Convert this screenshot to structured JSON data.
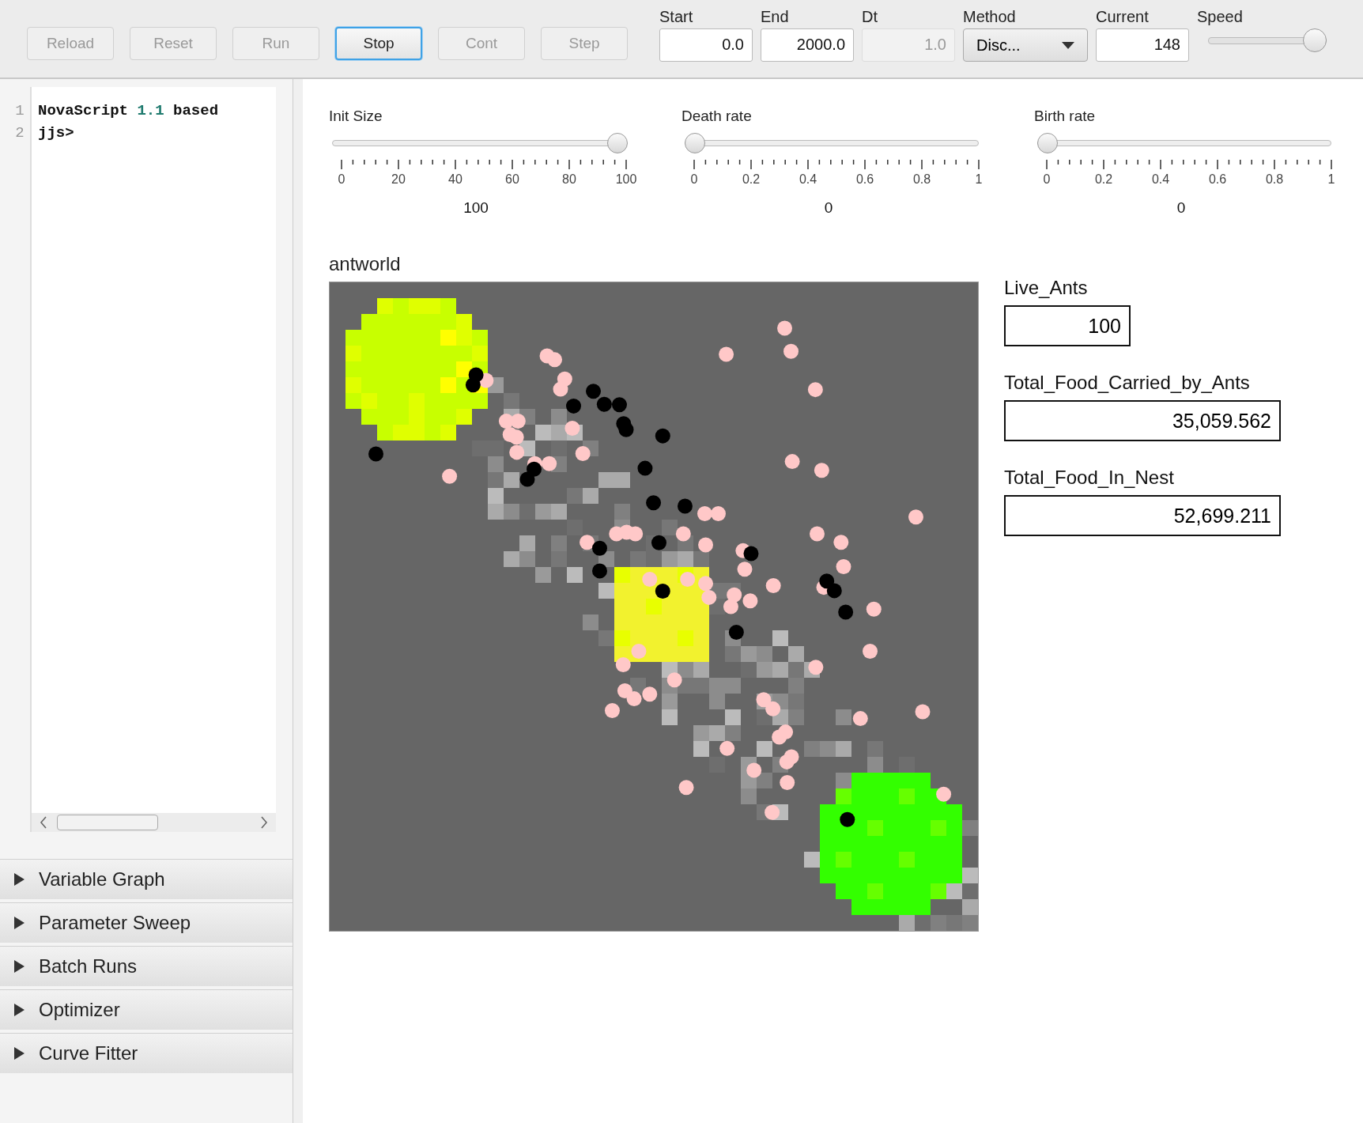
{
  "toolbar": {
    "buttons": [
      {
        "label": "Reload",
        "disabled": true,
        "focused": false
      },
      {
        "label": "Reset",
        "disabled": true,
        "focused": false
      },
      {
        "label": "Run",
        "disabled": true,
        "focused": false
      },
      {
        "label": "Stop",
        "disabled": false,
        "focused": true
      },
      {
        "label": "Cont",
        "disabled": true,
        "focused": false
      },
      {
        "label": "Step",
        "disabled": true,
        "focused": false
      }
    ],
    "fields": [
      {
        "label": "Start",
        "kind": "text",
        "value": "0.0",
        "disabled": false
      },
      {
        "label": "End",
        "kind": "text",
        "value": "2000.0",
        "disabled": false
      },
      {
        "label": "Dt",
        "kind": "text",
        "value": "1.0",
        "disabled": true
      },
      {
        "label": "Method",
        "kind": "dropdown",
        "value": "Disc..."
      },
      {
        "label": "Current",
        "kind": "text",
        "value": "148",
        "disabled": false
      },
      {
        "label": "Speed",
        "kind": "slider",
        "level": 1.0
      }
    ]
  },
  "editor": {
    "lines": [
      {
        "number": "1",
        "parts": [
          {
            "text": "NovaScript ",
            "kind": "plain"
          },
          {
            "text": "1.1",
            "kind": "number"
          },
          {
            "text": " based",
            "kind": "plain"
          }
        ]
      },
      {
        "number": "2",
        "parts": [
          {
            "text": "jjs>",
            "kind": "plain"
          }
        ]
      }
    ]
  },
  "panels": [
    {
      "label": "Variable Graph",
      "expanded": false
    },
    {
      "label": "Parameter Sweep",
      "expanded": false
    },
    {
      "label": "Batch Runs",
      "expanded": false
    },
    {
      "label": "Optimizer",
      "expanded": false
    },
    {
      "label": "Curve Fitter",
      "expanded": false
    }
  ],
  "sliders": [
    {
      "label": "Init Size",
      "level": 1.0,
      "ticks": [
        "0",
        "20",
        "40",
        "60",
        "80",
        "100"
      ],
      "value": "100"
    },
    {
      "label": "Death rate",
      "level": 0.0,
      "ticks": [
        "0",
        "0.2",
        "0.4",
        "0.6",
        "0.8",
        "1"
      ],
      "value": "0"
    },
    {
      "label": "Birth rate",
      "level": 0.0,
      "ticks": [
        "0",
        "0.2",
        "0.4",
        "0.6",
        "0.8",
        "1"
      ],
      "value": "0"
    }
  ],
  "world": {
    "title": "antworld"
  },
  "monitors": [
    {
      "label": "Live_Ants",
      "value": "100"
    },
    {
      "label": "Total_Food_Carried_by_Ants",
      "value": "35,059.562"
    },
    {
      "label": "Total_Food_In_Nest",
      "value": "52,699.211"
    }
  ]
}
